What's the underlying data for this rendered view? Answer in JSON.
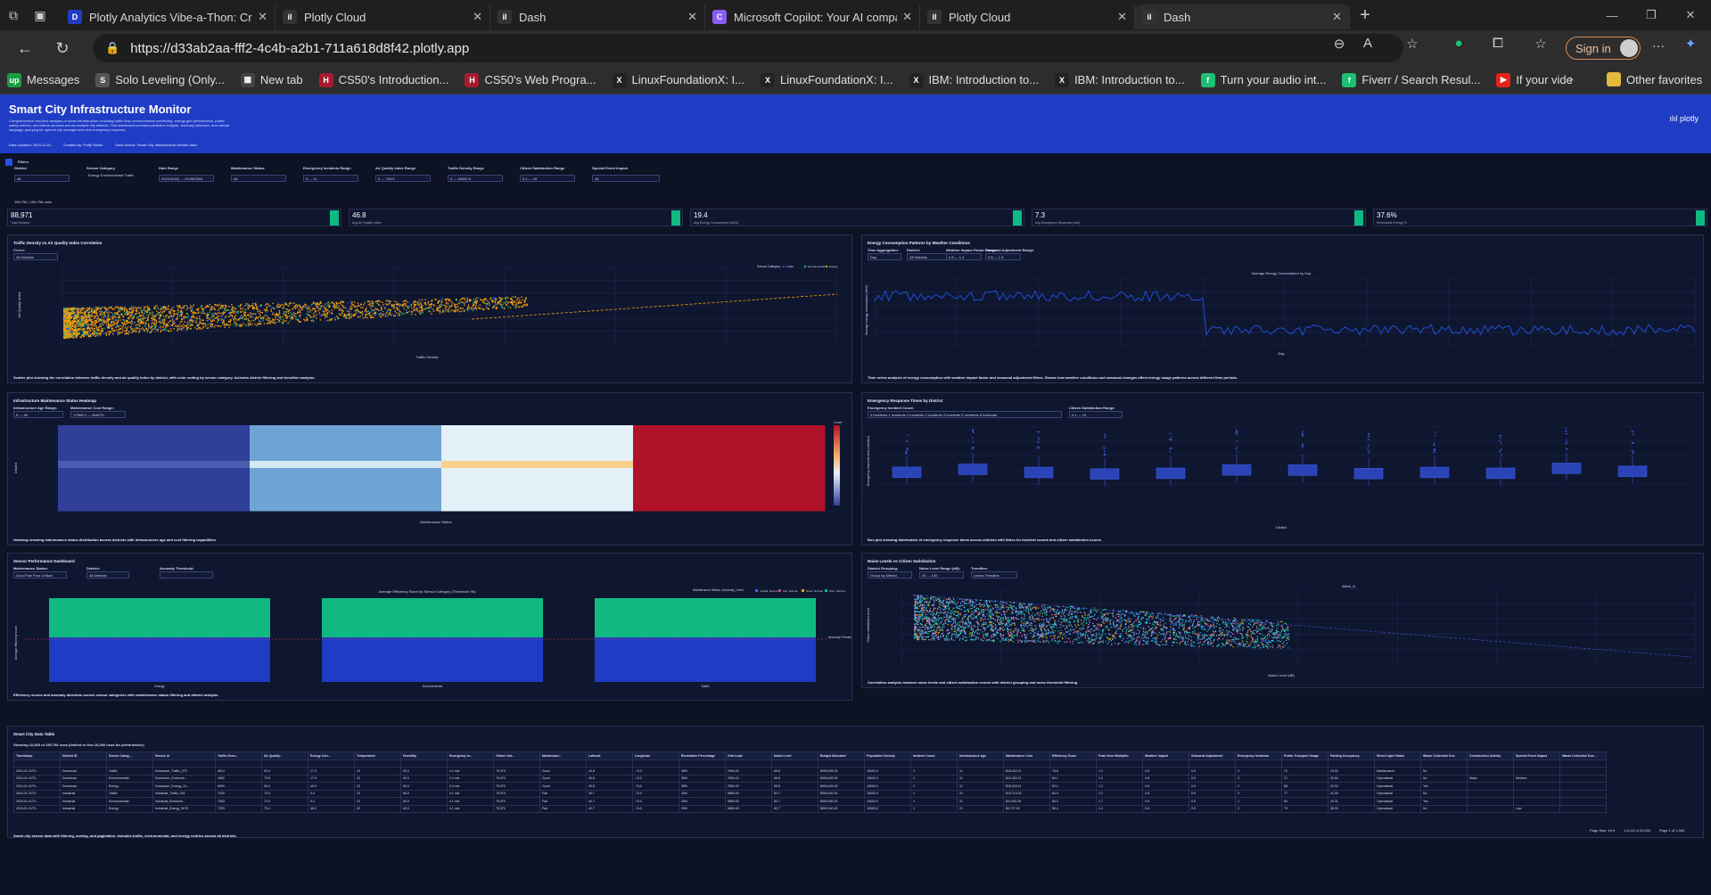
{
  "browser": {
    "tabs": [
      {
        "label": "Plotly Analytics Vibe-a-Thon: Crea",
        "favicon": "D",
        "active": false
      },
      {
        "label": "Plotly Cloud",
        "favicon": "il",
        "active": false
      },
      {
        "label": "Dash",
        "favicon": "il",
        "active": false
      },
      {
        "label": "Microsoft Copilot: Your AI compan",
        "favicon": "C",
        "active": false
      },
      {
        "label": "Plotly Cloud",
        "favicon": "il",
        "active": false
      },
      {
        "label": "Dash",
        "favicon": "il",
        "active": true
      }
    ],
    "url": "https://d33ab2aa-fff2-4c4b-a2b1-711a618d8f42.plotly.app",
    "signin_label": "Sign in",
    "bookmarks": [
      {
        "label": "Messages",
        "color": "#1a9e44",
        "glyph": "up"
      },
      {
        "label": "Solo Leveling (Only...",
        "color": "#555",
        "glyph": "S"
      },
      {
        "label": "New tab",
        "color": "#444",
        "glyph": "▦"
      },
      {
        "label": "CS50's Introduction...",
        "color": "#a51c30",
        "glyph": "H"
      },
      {
        "label": "CS50's Web Progra...",
        "color": "#a51c30",
        "glyph": "H"
      },
      {
        "label": "LinuxFoundationX: I...",
        "color": "#222",
        "glyph": "X"
      },
      {
        "label": "LinuxFoundationX: I...",
        "color": "#222",
        "glyph": "X"
      },
      {
        "label": "IBM: Introduction to...",
        "color": "#222",
        "glyph": "X"
      },
      {
        "label": "IBM: Introduction to...",
        "color": "#222",
        "glyph": "X"
      },
      {
        "label": "Turn your audio int...",
        "color": "#1dbf73",
        "glyph": "f"
      },
      {
        "label": "Fiverr / Search Resul...",
        "color": "#1dbf73",
        "glyph": "f"
      },
      {
        "label": "If your videos get st...",
        "color": "#e62117",
        "glyph": "▶"
      }
    ],
    "other_favorites": "Other favorites"
  },
  "app": {
    "title": "Smart City Infrastructure Monitor",
    "description": "Comprehensive real-time analysis of urban infrastructure including traffic flow, environmental monitoring, energy grid performance, public safety metrics, and citizen services across multiple city districts. This dashboard provides predictive insights, anomaly detection, and natural language querying for optimal city management and emergency response.",
    "meta": [
      "Data Updated: 2024-10-01",
      "Created by: Plotly Studio",
      "Data Source: Smart City Infrastructure Monitor data"
    ],
    "logo": "plotly",
    "filters_label": "Filters",
    "filters": [
      {
        "label": "District",
        "value": "All"
      },
      {
        "label": "Sensor Category",
        "value": "Energy  Environmental  Traffic"
      },
      {
        "label": "Date Range",
        "value": "01/01/2024 → 01/28/2024"
      },
      {
        "label": "Maintenance Status",
        "value": "All"
      },
      {
        "label": "Emergency Incidents Range",
        "value": "0 — 11"
      },
      {
        "label": "Air Quality Index Range",
        "value": "0 — 734.9"
      },
      {
        "label": "Traffic Density Range",
        "value": "0 — 45392.5"
      },
      {
        "label": "Citizen Satisfaction Range",
        "value": "0.1 — 10"
      },
      {
        "label": "Special Event Impact",
        "value": "All"
      }
    ],
    "rows_label": "155,796 / 155,796 rows",
    "kpis": [
      {
        "value": "88,971",
        "label": "Total Sensors"
      },
      {
        "value": "46.8",
        "label": "Avg Air Quality Index"
      },
      {
        "value": "19.4",
        "label": "Avg Energy Consumption (kWh)"
      },
      {
        "value": "7.3",
        "label": "Avg Emergency Response (min)"
      },
      {
        "value": "37.6%",
        "label": "Renewable Energy %"
      }
    ]
  },
  "panels": {
    "scatter": {
      "title": "Traffic Density vs Air Quality Index Correlation",
      "district_label": "District:",
      "district_value": "All Districts",
      "legend_title": "Sensor Category",
      "legend": [
        "Traffic",
        "Environmental",
        "Energy"
      ],
      "xlabel": "Traffic Density",
      "ylabel": "Air Quality Index",
      "caption": "Scatter plot showing the correlation between traffic density and air quality index by district, with color coding by sensor category. Includes district filtering and trendline analysis.",
      "colors": {
        "Traffic": "#1e4fd6",
        "Environmental": "#10b981",
        "Energy": "#f59e0b"
      }
    },
    "energy": {
      "title": "Energy Consumption Patterns by Weather Conditions",
      "controls": [
        {
          "label": "Time Aggregation:",
          "value": "Day"
        },
        {
          "label": "District:",
          "value": "All Districts"
        },
        {
          "label": "Weather Impact Factor Range:",
          "value": "0.8 — 1.4"
        },
        {
          "label": "Seasonal Adjustment Range:",
          "value": "0.8 — 1.3"
        }
      ],
      "chart_title": "Average Energy Consumption by Day",
      "ylabel": "Average energy consumption (kWh)",
      "xlabel": "Day",
      "caption": "Time series analysis of energy consumption with weather impact factor and seasonal adjustment filters. Shows how weather conditions and seasonal changes affect energy usage patterns across different time periods."
    },
    "heatmap": {
      "title": "Infrastructure Maintenance Status Heatmap",
      "controls": [
        {
          "label": "Infrastructure Age Range:",
          "value": "0 — 49"
        },
        {
          "label": "Maintenance Cost Range:",
          "value": "17966.3 — 264679..."
        }
      ],
      "xlabel": "Maintenance Status",
      "ylabel": "District",
      "colorbar_label": "Count",
      "caption": "Heatmap showing maintenance status distribution across districts with infrastructure age and cost filtering capabilities"
    },
    "boxplot": {
      "title": "Emergency Response Times by District",
      "controls": [
        {
          "label": "Emergency Incident Count:",
          "value": "0 Incidents  1 Incidents  2 Incidents  3 Incidents  4 Incidents  5 Incidents  6 Incidents"
        },
        {
          "label": "Citizen Satisfaction Range:",
          "value": "0.1 — 10"
        }
      ],
      "xlabel": "District",
      "ylabel": "Emergency response time (minutes)",
      "caption": "Box plot showing distribution of emergency response times across districts with filters for incident counts and citizen satisfaction scores"
    },
    "sensor": {
      "title": "Sensor Performance Dashboard",
      "controls": [
        {
          "label": "Maintenance Status:",
          "value": "Good  Fair  Poor  Critical"
        },
        {
          "label": "District:",
          "value": "All Districts"
        },
        {
          "label": "Anomaly Threshold:",
          "value": ""
        }
      ],
      "chart_title": "Average Efficiency Score by Sensor Category (Threshold: 95)",
      "legend_title": "Maintenance Status, Anomaly_Level",
      "legend": [
        "Critical, Normal",
        "Fair, Normal",
        "Good, Normal",
        "Poor, Normal"
      ],
      "categories": [
        "Energy",
        "Environmental",
        "Traffic"
      ],
      "xlabel": "Sensor Category",
      "ylabel": "Average efficiency score",
      "threshold_label": "Anomaly Threshold (95)",
      "caption": "Efficiency scores and anomaly detection across sensor categories with maintenance status filtering and district analysis"
    },
    "noise": {
      "title": "Noise Levels vs Citizen Satisfaction",
      "controls": [
        {
          "label": "District Grouping:",
          "value": "Group by District"
        },
        {
          "label": "Noise Level Range (dB):",
          "value": "30 — 100"
        },
        {
          "label": "Trendline:",
          "value": "Linear Trendline"
        }
      ],
      "legend_title": "district_id",
      "xlabel": "Noise Level (dB)",
      "ylabel": "Citizen satisfaction score",
      "caption": "Correlation analysis between noise levels and citizen satisfaction scores with district grouping and noise threshold filtering"
    },
    "table": {
      "title": "Smart City Data Table",
      "subtitle": "Showing 10,000 of 155,796 rows (limited to first 10,000 rows for performance)",
      "columns": [
        "Timestamp",
        "District ID",
        "Sensor Categ...",
        "Sensor Id",
        "Traffic Dens...",
        "Air Quality...",
        "Energy Con...",
        "Temperature",
        "Humidity",
        "Emergency In...",
        "Citizen Sat...",
        "Maintenanc...",
        "Latitude",
        "Longitude",
        "Renewable Percentage",
        "Grid Load",
        "Noise Level",
        "Budget Allocated",
        "Population Density",
        "Incident Count",
        "Infrastructure Age",
        "Maintenance Cost",
        "Efficiency Score",
        "Peak Hour Multiplier",
        "Weather Impact",
        "Seasonal Adjustment",
        "Emergency Incidents",
        "Public Transport Usage",
        "Parking Occupancy",
        "Street Light Status",
        "Waste Collection Due",
        "Construction Activity",
        "Special Event Impact",
        "Waste Collection Due ..."
      ],
      "rows": [
        [
          "2024-01-01T0...",
          "Downtown",
          "Traffic",
          "Downtown_Traffic_079",
          "6914",
          "93.4",
          "17.3",
          "22",
          "63.0",
          "2.4 min",
          "78.370",
          "Good",
          "40.8",
          "-74.0",
          "38%",
          "2954.20",
          "65.8",
          "$990,635.93",
          "15000.0",
          "2",
          "11",
          "$18,320.21",
          "78.8",
          "1.2",
          "0.8",
          "0.9",
          "2",
          "70",
          "19.50",
          "Maintenance",
          "No",
          "",
          "",
          ""
        ],
        [
          "2024-01-01T0...",
          "Downtown",
          "Environmental",
          "Downtown_Environm...",
          "4352",
          "70.8",
          "17.9",
          "22",
          "63.0",
          "2.4 min",
          "78.370",
          "Good",
          "40.8",
          "-74.0",
          "38%",
          "2954.20",
          "65.8",
          "$990,635.93",
          "15000.0",
          "2",
          "11",
          "$12,320.21",
          "84.1",
          "1.2",
          "0.8",
          "0.9",
          "3",
          "71",
          "32.64",
          "Operational",
          "No",
          "Major",
          "Medium",
          ""
        ],
        [
          "2024-01-01T0...",
          "Downtown",
          "Energy",
          "Downtown_Energy_31...",
          "6900",
          "93.4",
          "49.9",
          "22",
          "63.0",
          "2.4 min",
          "78.370",
          "Good",
          "40.8",
          "-74.0",
          "38%",
          "2954.20",
          "65.8",
          "$990,635.93",
          "15000.0",
          "2",
          "11",
          "$18,320.21",
          "82.1",
          "1.2",
          "0.8",
          "0.9",
          "2",
          "68",
          "22.04",
          "Operational",
          "Yes",
          "",
          "",
          ""
        ],
        [
          "2024-01-01T0...",
          "Industrial",
          "Traffic",
          "Industrial_Traffic_024",
          "7020",
          "73.4",
          "9.4",
          "22",
          "60.0",
          "4.1 min",
          "78.370",
          "Fair",
          "40.7",
          "-74.0",
          "25%",
          "6850.00",
          "82.7",
          "$990,540.00",
          "15000.0",
          "1",
          "21",
          "$13,710.00",
          "84.4",
          "1.2",
          "0.8",
          "0.9",
          "3",
          "77",
          "41.00",
          "Operational",
          "No",
          "",
          "",
          ""
        ],
        [
          "2024-01-01T0...",
          "Industrial",
          "Environmental",
          "Industrial_Environm...",
          "7053",
          "72.0",
          "9.4",
          "22",
          "60.0",
          "4.1 min",
          "78.370",
          "Fair",
          "40.7",
          "-74.0",
          "25%",
          "6850.00",
          "82.7",
          "$990,540.00",
          "15000.0",
          "1",
          "21",
          "$11,930.29",
          "80.3",
          "1.7",
          "0.8",
          "0.9",
          "1",
          "63",
          "20.31",
          "Operational",
          "Yes",
          "",
          "",
          ""
        ],
        [
          "2024-01-01T0...",
          "Industrial",
          "Energy",
          "Industrial_Energy_0675",
          "7253",
          "73.4",
          "48.2",
          "22",
          "60.0",
          "4.1 min",
          "78.370",
          "Fair",
          "40.7",
          "-74.0",
          "25%",
          "6850.00",
          "82.7",
          "$990,540.00",
          "15000.0",
          "1",
          "21",
          "$9,727.00",
          "85.4",
          "1.2",
          "0.8",
          "0.9",
          "2",
          "79",
          "38.03",
          "Operational",
          "No",
          "",
          "Low",
          ""
        ]
      ],
      "pager": "Page Size: 10 ▾",
      "pager_count": "1 to 10 of 10,000",
      "pager_nav": "Page 1 of 1,000",
      "caption": "Smart city sensor data with filtering, sorting, and pagination. Includes traffic, environmental, and energy metrics across all districts."
    }
  }
}
